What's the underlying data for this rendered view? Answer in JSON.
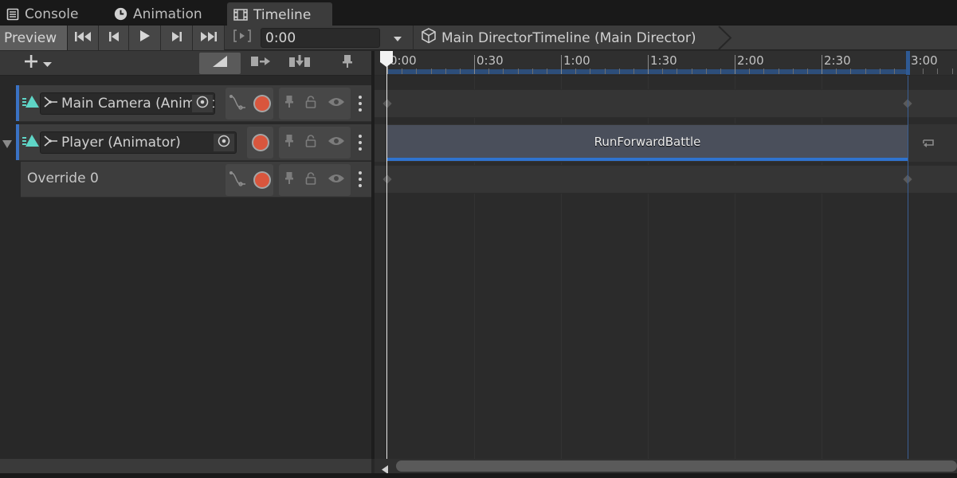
{
  "tabs": [
    {
      "label": "Console",
      "icon": "console-icon"
    },
    {
      "label": "Animation",
      "icon": "clock-icon"
    },
    {
      "label": "Timeline",
      "icon": "film-icon",
      "active": true
    }
  ],
  "toolbar": {
    "preview_label": "Preview",
    "time_value": "0:00",
    "breadcrumb": "Main DirectorTimeline (Main Director)"
  },
  "tracks": [
    {
      "label": "Main Camera (Animator)",
      "type": "animation-track"
    },
    {
      "label": "Player (Animator)",
      "type": "animation-track",
      "collapsible": true
    },
    {
      "label": "Override 0",
      "type": "override-track"
    }
  ],
  "timeline": {
    "ruler_labels": [
      "0:00",
      "0:30",
      "1:00",
      "1:30",
      "2:00",
      "2:30",
      "3:00"
    ],
    "clip_label": "RunForwardBattle"
  },
  "colors": {
    "accent": "#3a72c4",
    "record": "#d9563d",
    "clip": "#4a4f5b",
    "track_icon": "#5fd6c7"
  }
}
